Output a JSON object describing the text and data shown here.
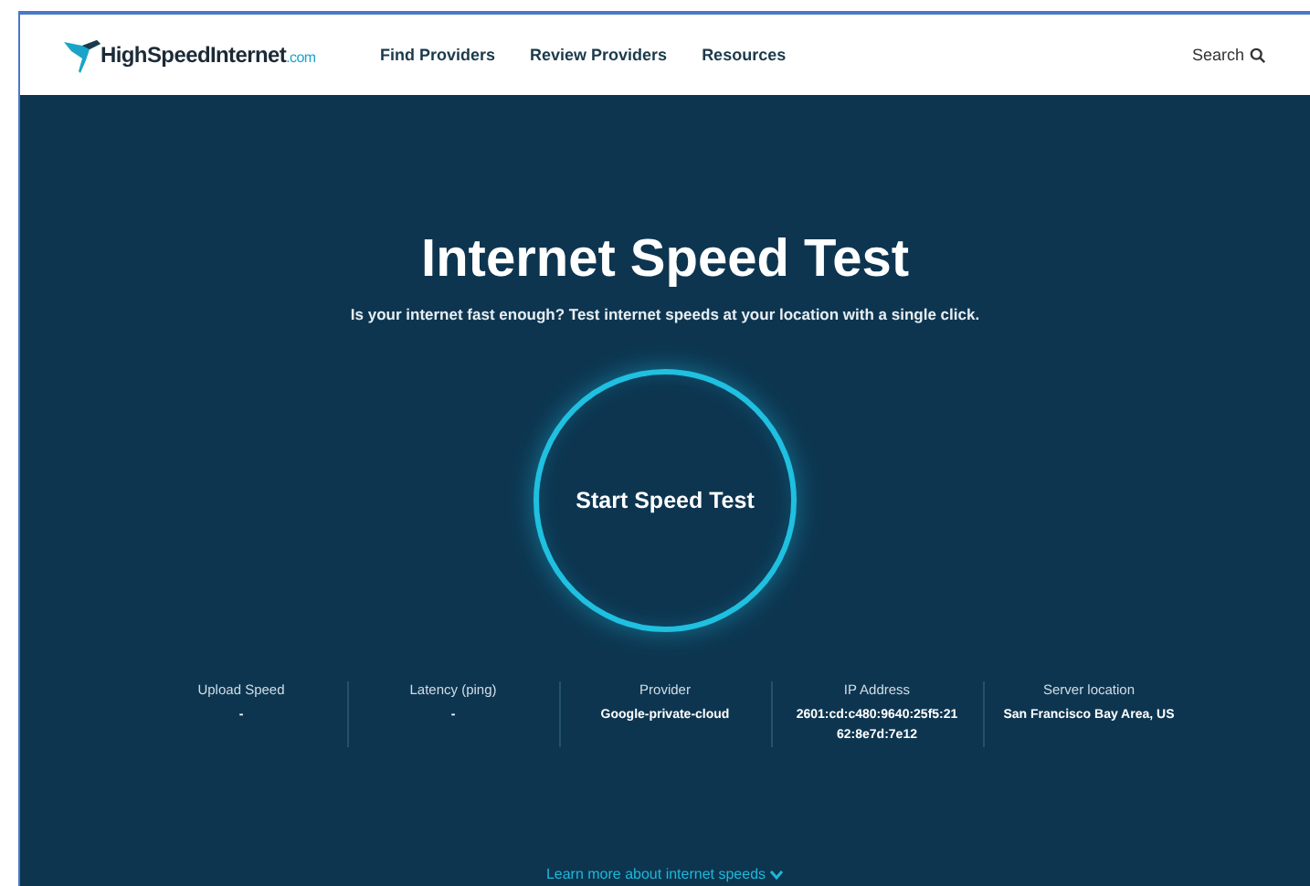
{
  "header": {
    "logo": {
      "name": "HighSpeedInternet",
      "suffix": ".com"
    },
    "nav": [
      "Find Providers",
      "Review Providers",
      "Resources"
    ],
    "search": "Search"
  },
  "hero": {
    "title": "Internet Speed Test",
    "subtitle": "Is your internet fast enough? Test internet speeds at your location with a single click.",
    "button": "Start Speed Test"
  },
  "stats": [
    {
      "label": "Upload Speed",
      "value": "-"
    },
    {
      "label": "Latency (ping)",
      "value": "-"
    },
    {
      "label": "Provider",
      "value": "Google-private-cloud"
    },
    {
      "label": "IP Address",
      "value": "2601:cd:c480:9640:25f5:21 62:8e7d:7e12"
    },
    {
      "label": "Server location",
      "value": "San Francisco Bay Area, US"
    }
  ],
  "footer_link": "Learn more about internet speeds"
}
